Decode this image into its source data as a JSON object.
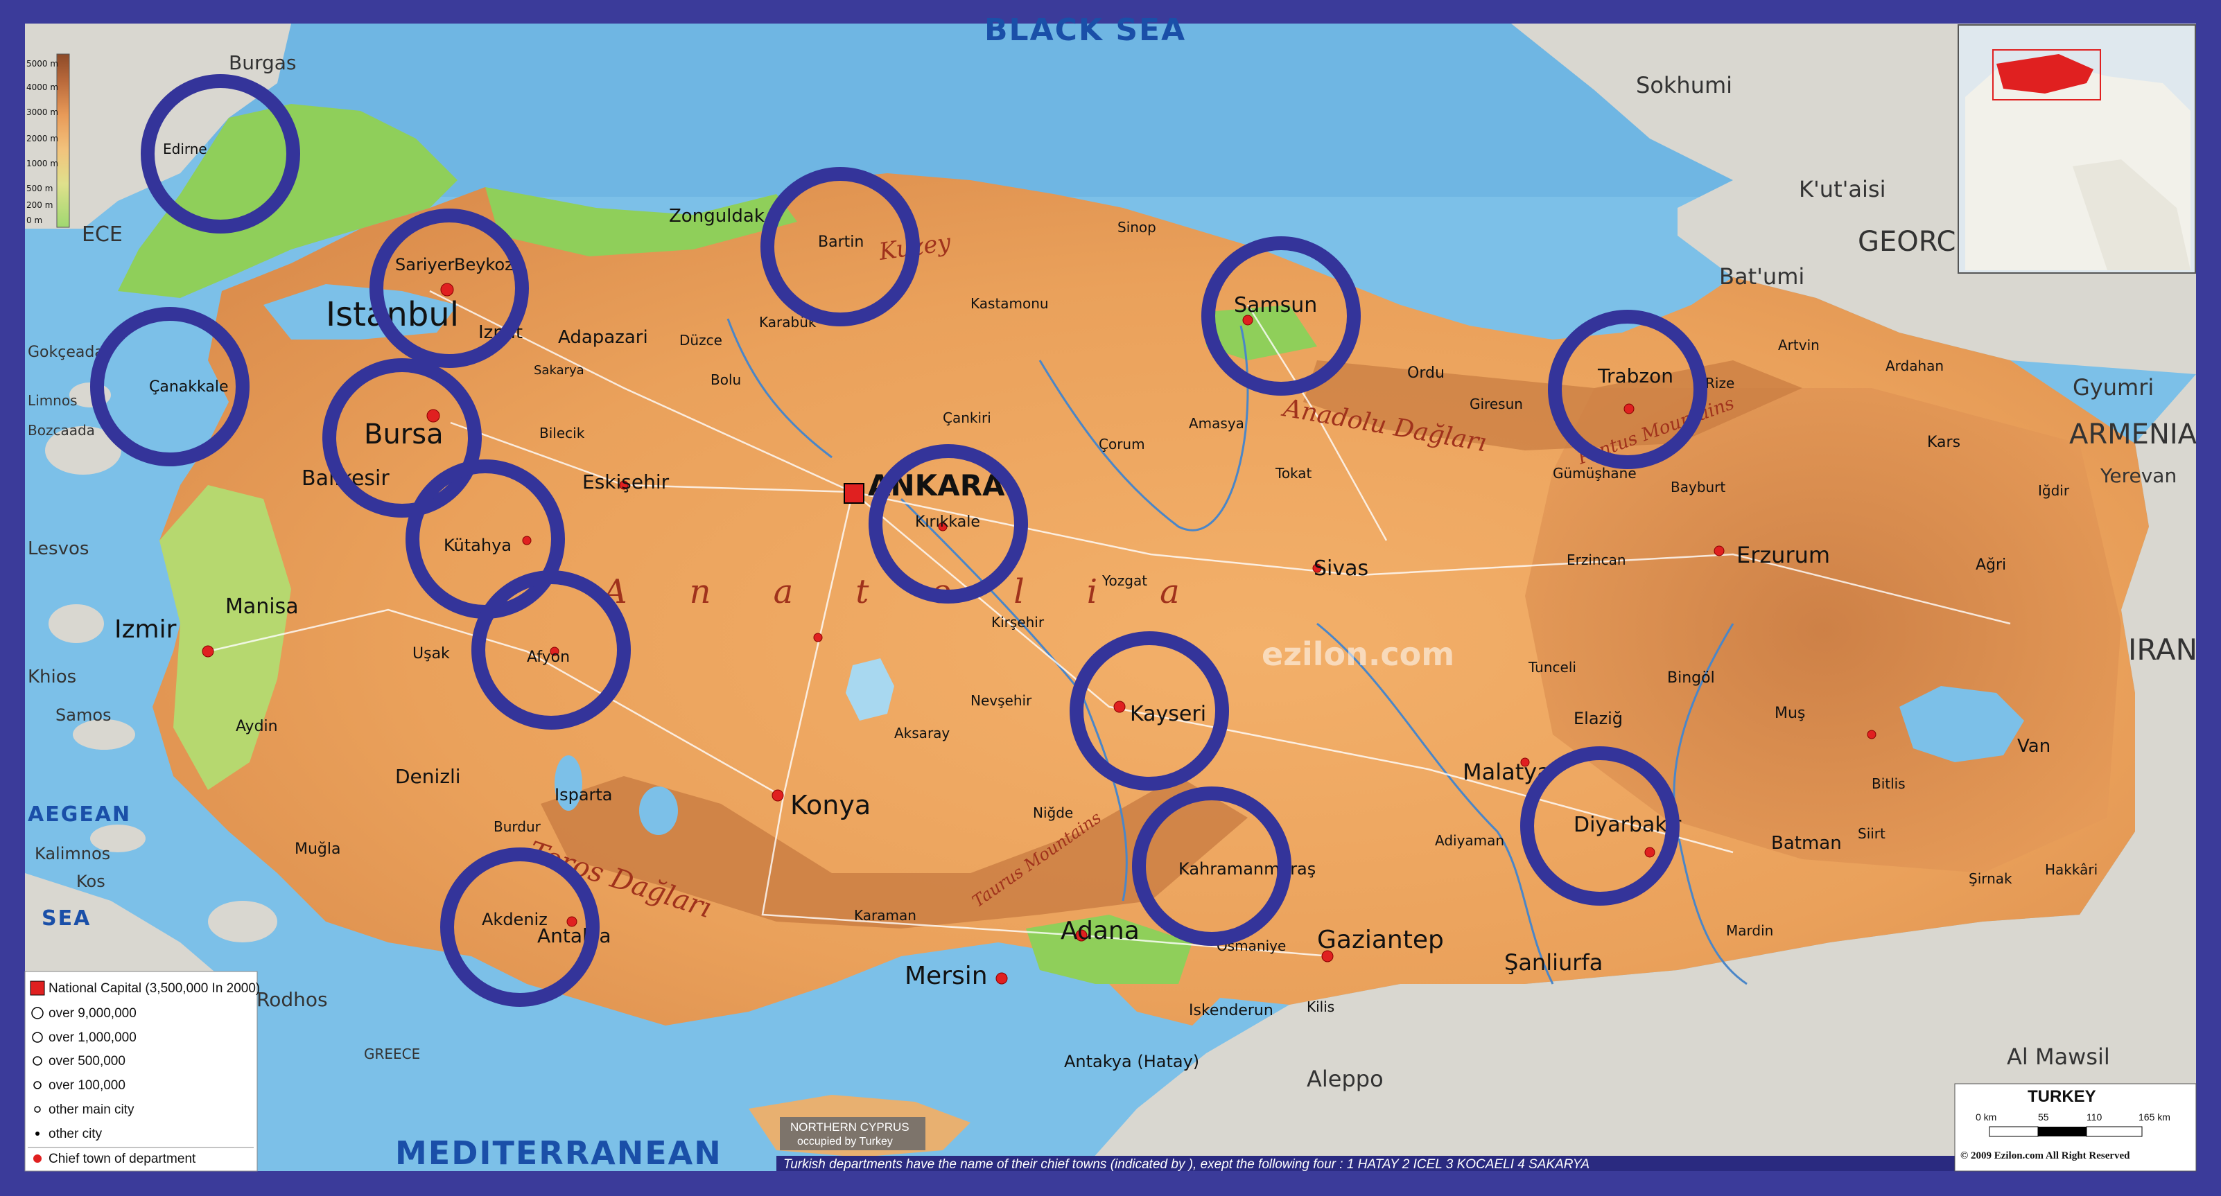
{
  "seas": {
    "black_sea": "BLACK SEA",
    "mediterranean": "MEDITERRANEAN",
    "aegean": "AEGEAN",
    "aegean_sea": "SEA"
  },
  "countries": {
    "greece_left": "ECE",
    "greece_bottom": "GREECE",
    "georgia": "GEORC",
    "armenia": "ARMENIA",
    "iran": "IRAN",
    "northern_cyprus": "NORTHERN CYPRUS",
    "northern_cyprus_note": "occupied by Turkey"
  },
  "foreign_cities": [
    "Burgas",
    "Sokhumi",
    "K'ut'aisi",
    "Bat'umi",
    "Gyumri",
    "Yerevan",
    "Aleppo",
    "Al Mawsil",
    "Rodhos",
    "Lesvos",
    "Khios",
    "Samos",
    "Kalimnos",
    "Kos",
    "Limnos",
    "Gokçeada",
    "Bozcaada"
  ],
  "regions": [
    {
      "text": "Kuzey"
    },
    {
      "text": "Anadolu Dağları"
    },
    {
      "text": "Anatolia"
    },
    {
      "text": "Toros Dağları"
    },
    {
      "text": "Taurus Mountains"
    },
    {
      "text": "Pontus Mountains"
    }
  ],
  "capital": "ANKARA",
  "major_cities": [
    "Istanbul",
    "Bursa",
    "Izmir",
    "Konya",
    "Adana",
    "Mersin",
    "Gaziantep",
    "Kayseri",
    "Samsun",
    "Trabzon",
    "Erzurum",
    "Diyarbakir",
    "Antalya",
    "Eskişehir",
    "Şanliurfa",
    "Malatya",
    "Sivas",
    "Denizli",
    "Manisa",
    "Balıkesir",
    "Kahramanmaraş",
    "Kırıkkale",
    "Zonguldak",
    "Adapazari",
    "Izmit",
    "Kütahya",
    "Afyon",
    "Çanakkale",
    "Edirne",
    "Sariyer",
    "Beykoz",
    "Bartin",
    "Akdeniz",
    "Antakya (Hatay)",
    "Iskenderun",
    "Elaziğ",
    "Batman",
    "Van",
    "Isparta",
    "Aydin",
    "Uşak",
    "Tokat",
    "Çorum",
    "Ordu",
    "Giresun",
    "Rize",
    "Artvin",
    "Kars",
    "Ağri",
    "Muş",
    "Bitlis",
    "Siirt",
    "Şirnak",
    "Hakkâri",
    "Mardin",
    "Niğde",
    "Aksaray",
    "Nevşehir",
    "Kirşehir",
    "Yozgat",
    "Amasya",
    "Sinop",
    "Kastamonu",
    "Çankiri",
    "Karabük",
    "Bolu",
    "Düzce",
    "Sakarya",
    "Bilecik",
    "Karaman",
    "Burdur",
    "Muğla",
    "Osmaniye",
    "Kilis",
    "Adiyaman",
    "Tunceli",
    "Bingöl",
    "Erzincan",
    "Gümüşhane",
    "Bayburt",
    "Ardahan",
    "Iğdir"
  ],
  "legend": {
    "items": [
      {
        "label": "National Capital (3,500,000 In 2000)"
      },
      {
        "label": "over 9,000,000"
      },
      {
        "label": "over 1,000,000"
      },
      {
        "label": "over 500,000"
      },
      {
        "label": "over 100,000"
      },
      {
        "label": "other main city"
      },
      {
        "label": "other city"
      },
      {
        "label": "Chief town of department"
      }
    ]
  },
  "elevation_scale": [
    "5000 m",
    "4000 m",
    "3000 m",
    "2000 m",
    "1000 m",
    "500 m",
    "200 m",
    "0 m"
  ],
  "footnote": "Turkish departments have the name of their chief towns (indicated by  ), exept the following four : 1 HATAY  2 ICEL  3 KOCAELI  4 SAKARYA",
  "scale_bar": {
    "title": "TURKEY",
    "ticks": [
      "0 km",
      "55",
      "110",
      "165 km"
    ],
    "copyright": "© 2009 Ezilon.com All Right Reserved"
  },
  "watermark": "ezilon.com",
  "colors": {
    "frame": "#3b3b9a",
    "sea": "#7cc0e8",
    "land_low": "#8fcf5a",
    "land_mid": "#f0a860",
    "land_high": "#c46a2f",
    "foreign_land": "#d9d7d0",
    "circle": "#34349a",
    "capital": "#e02020"
  }
}
